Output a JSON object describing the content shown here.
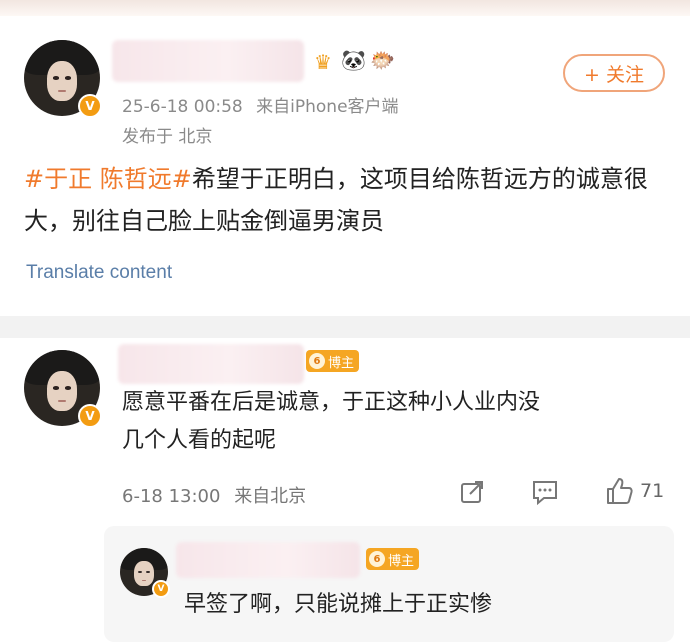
{
  "post": {
    "timestamp": "25-6-18 00:58",
    "source": "来自iPhone客户端",
    "location": "发布于 北京",
    "follow_label": "+ 关注",
    "tags": "#于正 陈哲远#",
    "body": "希望于正明白，这项目给陈哲远方的诚意很大，别往自己脸上贴金倒逼男演员",
    "translate_label": "Translate content",
    "badges": [
      "crown-badge-icon",
      "panda-icon",
      "fish-icon"
    ]
  },
  "comment": {
    "blogger_tag": "博主",
    "blogger_level": "6",
    "text_line1": "愿意平番在后是诚意，于正这种小人业内没",
    "text_line2": "几个人看的起呢",
    "timestamp": "6-18 13:00",
    "location": "来自北京",
    "likes": "71"
  },
  "reply": {
    "blogger_tag": "博主",
    "blogger_level": "6",
    "text": "早签了啊，只能说摊上于正实惨"
  },
  "colors": {
    "accent": "#f07a2c",
    "link": "#5a7ea8",
    "meta": "#8a8a8a",
    "blogger": "#f5a623"
  }
}
